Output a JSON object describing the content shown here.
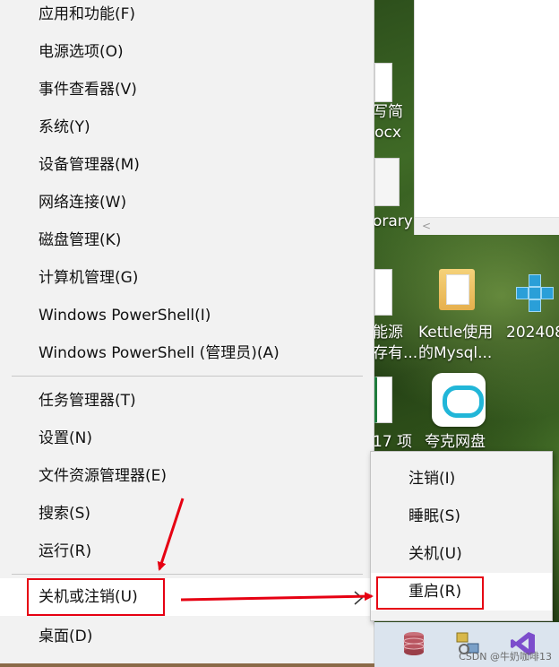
{
  "menu": {
    "items": [
      {
        "label": "应用和功能(F)"
      },
      {
        "label": "电源选项(O)"
      },
      {
        "label": "事件查看器(V)"
      },
      {
        "label": "系统(Y)"
      },
      {
        "label": "设备管理器(M)"
      },
      {
        "label": "网络连接(W)"
      },
      {
        "label": "磁盘管理(K)"
      },
      {
        "label": "计算机管理(G)"
      },
      {
        "label": "Windows PowerShell(I)"
      },
      {
        "label": "Windows PowerShell (管理员)(A)"
      },
      {
        "label": "任务管理器(T)"
      },
      {
        "label": "设置(N)"
      },
      {
        "label": "文件资源管理器(E)"
      },
      {
        "label": "搜索(S)"
      },
      {
        "label": "运行(R)"
      },
      {
        "label": "关机或注销(U)"
      },
      {
        "label": "桌面(D)"
      }
    ]
  },
  "submenu": {
    "items": [
      {
        "label": "注销(I)"
      },
      {
        "label": "睡眠(S)"
      },
      {
        "label": "关机(U)"
      },
      {
        "label": "重启(R)"
      }
    ]
  },
  "desktop": {
    "icons": [
      {
        "line1": "写简",
        "line2": "ocx"
      },
      {
        "line1": "",
        "line2": "orary"
      },
      {
        "line1": "能源",
        "line2": "存有..."
      },
      {
        "line1": "Kettle使用",
        "line2": "的Mysql..."
      },
      {
        "line1": "202408",
        "line2": ""
      },
      {
        "line1": "17 项",
        "line2": ""
      },
      {
        "line1": "夸克网盘",
        "line2": ""
      }
    ],
    "scroll_glyph": "<"
  },
  "taskbar": {
    "icons": [
      "database-icon",
      "server-config-icon",
      "visual-studio-icon"
    ]
  },
  "watermark": "CSDN @牛奶咖啡13",
  "colors": {
    "annotation": "#e60012",
    "menu_bg": "#f2f2f2",
    "highlight_bg": "#ffffff"
  }
}
